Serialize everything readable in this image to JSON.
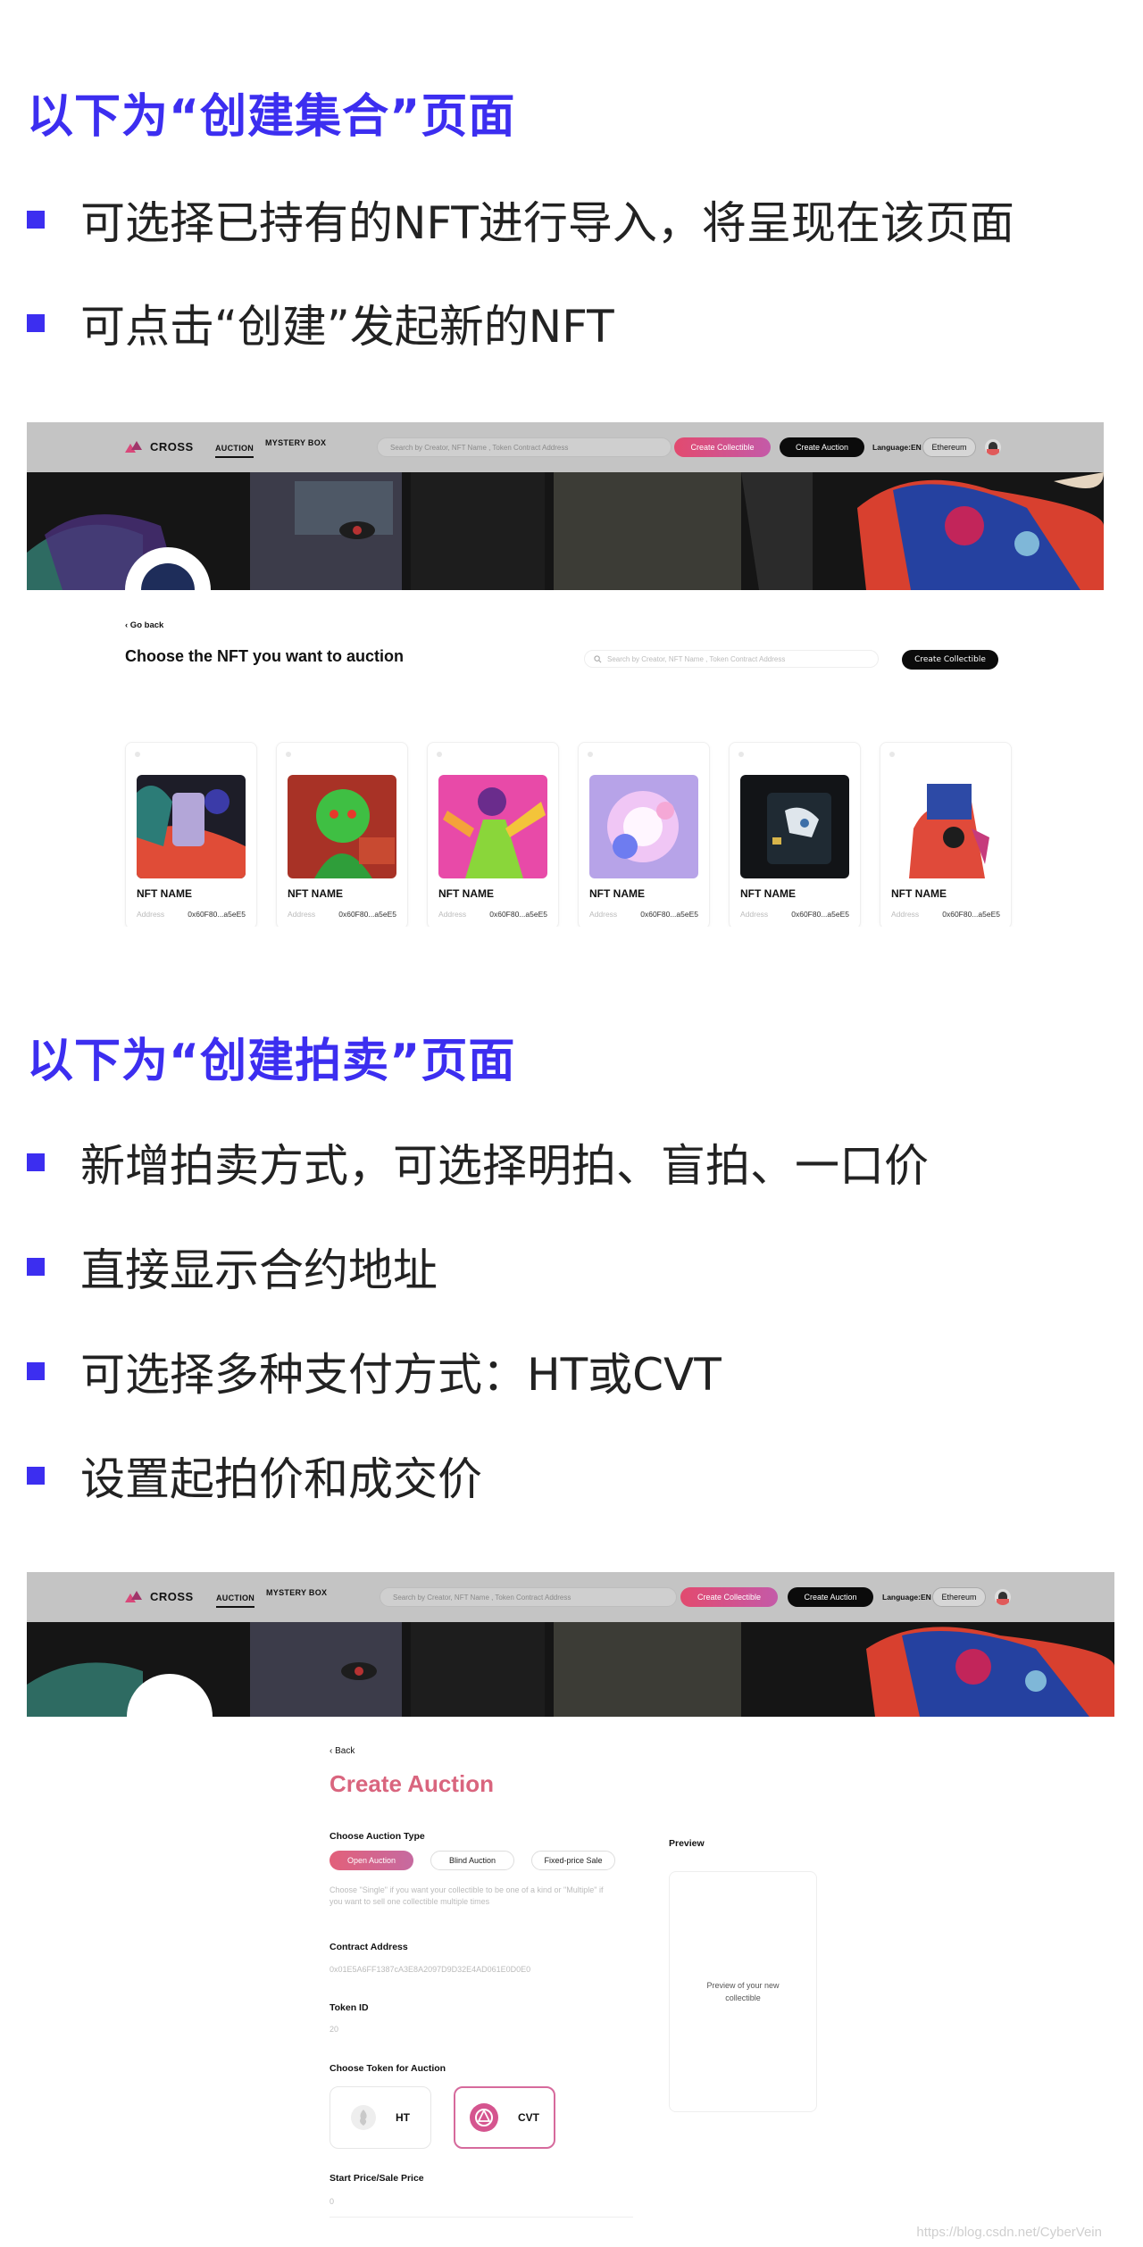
{
  "section1": {
    "heading": "以下为“创建集合”页面",
    "bullets": [
      "可选择已持有的NFT进行导入，将呈现在该页面",
      "可点击“创建”发起新的NFT"
    ]
  },
  "screenshot1": {
    "nav": {
      "brand": "CROSS",
      "link_auction": "AUCTION",
      "link_mystery": "MYSTERY BOX",
      "search_placeholder": "Search by Creator, NFT Name , Token Contract Address",
      "create_collectible": "Create Collectible",
      "create_auction": "Create Auction",
      "language": "Language:EN",
      "network": "Ethereum"
    },
    "go_back": "‹ Go back",
    "page_title": "Choose the NFT you want to auction",
    "search_placeholder": "Search by Creator, NFT Name , Token Contract Address",
    "create_button": "Create Collectible",
    "cards": [
      {
        "name": "NFT NAME",
        "address_label": "Address",
        "address": "0x60F80...a5eE5"
      },
      {
        "name": "NFT NAME",
        "address_label": "Address",
        "address": "0x60F80...a5eE5"
      },
      {
        "name": "NFT NAME",
        "address_label": "Address",
        "address": "0x60F80...a5eE5"
      },
      {
        "name": "NFT NAME",
        "address_label": "Address",
        "address": "0x60F80...a5eE5"
      },
      {
        "name": "NFT NAME",
        "address_label": "Address",
        "address": "0x60F80...a5eE5"
      },
      {
        "name": "NFT NAME",
        "address_label": "Address",
        "address": "0x60F80...a5eE5"
      }
    ]
  },
  "section2": {
    "heading": "以下为“创建拍卖”页面",
    "bullets": [
      "新增拍卖方式，可选择明拍、盲拍、一口价",
      "直接显示合约地址",
      "可选择多种支付方式：HT或CVT",
      "设置起拍价和成交价"
    ]
  },
  "screenshot2": {
    "back": "‹ Back",
    "title": "Create Auction",
    "auction_type_label": "Choose Auction Type",
    "auction_types": [
      "Open Auction",
      "Blind Auction",
      "Fixed-price Sale"
    ],
    "auction_hint": "Choose \"Single\" if you want your collectible to be one of a kind or \"Multiple\" if you want to sell one collectible multiple times",
    "contract_label": "Contract Address",
    "contract_value": "0x01E5A6FF1387cA3E8A2097D9D32E4AD061E0D0E0",
    "token_id_label": "Token ID",
    "token_id_value": "20",
    "token_label": "Choose Token for Auction",
    "tokens": [
      "HT",
      "CVT"
    ],
    "start_price_label": "Start Price/Sale Price",
    "start_price_value": "0",
    "preview_label": "Preview",
    "preview_text": "Preview of your new collectible"
  },
  "watermark": "https://blog.csdn.net/CyberVein",
  "colors": {
    "accent": "#3c2ef0",
    "gradient_start": "#e24a6f",
    "gradient_end": "#c45aa8"
  }
}
